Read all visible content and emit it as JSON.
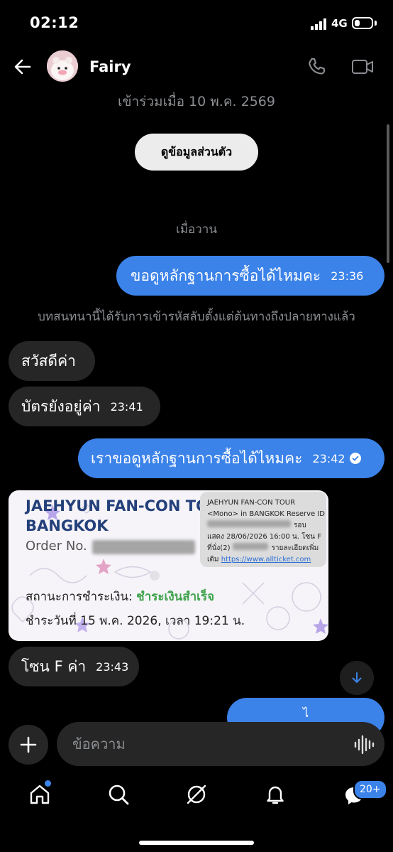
{
  "status_bar": {
    "time": "02:12",
    "network": "4G",
    "battery_level": 0.3
  },
  "header": {
    "contact_name": "Fairy",
    "back_icon": "arrow-left-icon",
    "call_icon": "phone-icon",
    "video_icon": "video-camera-icon"
  },
  "conversation": {
    "joined_text": "เข้าร่วมเมื่อ 10 พ.ค. 2569",
    "profile_button_label": "ดูข้อมูลส่วนตัว",
    "date_divider": "เมื่อวาน",
    "encryption_notice": "บทสนทนานี้ได้รับการเข้ารหัสลับตั้งแต่ต้นทางถึงปลายทางแล้ว",
    "messages": [
      {
        "direction": "outgoing",
        "text": "ขอดูหลักฐานการซื้อได้ไหมคะ",
        "time": "23:36"
      },
      {
        "direction": "incoming",
        "text": "สวัสดีค่า",
        "time": ""
      },
      {
        "direction": "incoming",
        "text": "บัตรยังอยู่ค่า",
        "time": "23:41"
      },
      {
        "direction": "outgoing",
        "text": "เราขอดูหลักฐานการซื้อได้ไหมคะ",
        "time": "23:42",
        "status": "read"
      },
      {
        "direction": "incoming",
        "type": "image"
      },
      {
        "direction": "incoming",
        "text": "โซน F ค่า",
        "time": "23:43"
      },
      {
        "direction": "outgoing",
        "text": "ไ",
        "time": ""
      }
    ]
  },
  "ticket_image": {
    "title_line1": "JAEHYUN FAN-CON TO",
    "title_line2": "BANGKOK",
    "order_label": "Order No.",
    "payment_status_label": "สถานะการชำระเงิน:",
    "payment_status_value": "ชำระเงินสำเร็จ",
    "paid_on": "ชำระวันที่ 15 พ.ค. 2026, เวลา 19:21 น.",
    "sms": {
      "line1": "JAEHYUN FAN-CON TOUR",
      "line2": "<Mono> in BANGKOK Reserve ID",
      "line3_end": "รอบ",
      "line4": "แสดง 28/06/2026 16:00 น. โซน F",
      "line5_start": "ที่นั่ง(2)",
      "line5_end": "รายละเอียดเพิ่ม",
      "line6_start": "เติม",
      "link": "https://www.allticket.com"
    }
  },
  "composer": {
    "placeholder": "ข้อความ",
    "add_icon": "plus-icon",
    "voice_icon": "voice-wave-icon"
  },
  "tabbar": {
    "items": [
      "home-icon",
      "search-icon",
      "explore-icon",
      "bell-icon",
      "messages-icon"
    ],
    "messages_badge": "20+"
  },
  "colors": {
    "accent": "#3b82e9",
    "incoming_bubble": "#262626",
    "background": "#000000"
  }
}
